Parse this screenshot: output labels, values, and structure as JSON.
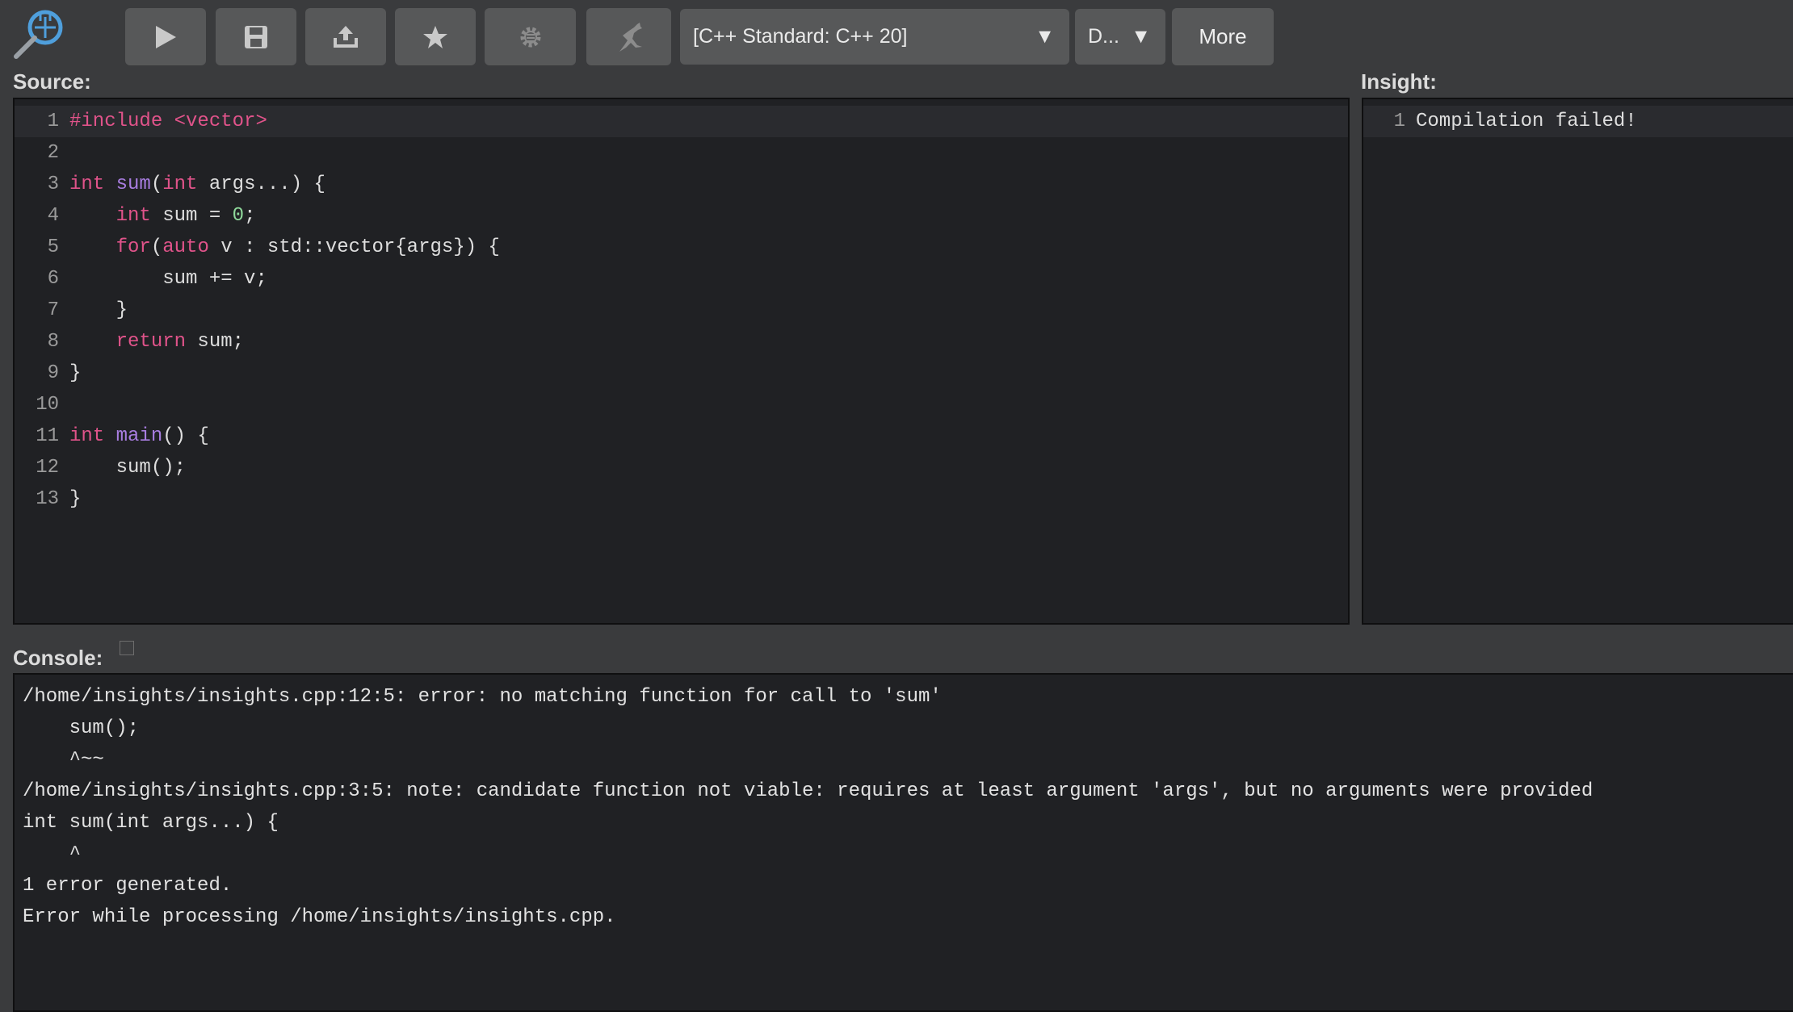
{
  "toolbar": {
    "buttons": [
      {
        "name": "run-button",
        "icon": "play-icon"
      },
      {
        "name": "save-button",
        "icon": "save-icon"
      },
      {
        "name": "upload-button",
        "icon": "upload-icon"
      },
      {
        "name": "favorite-button",
        "icon": "star-icon"
      },
      {
        "name": "settings-button",
        "icon": "gear-icon"
      },
      {
        "name": "kangaroo-button",
        "icon": "kangaroo-icon"
      }
    ],
    "standard_select": "[C++ Standard: C++ 20]",
    "secondary_select": "D...",
    "more_label": "More"
  },
  "source": {
    "label": "Source:",
    "lines": [
      {
        "n": "1",
        "parts": [
          {
            "t": "#include <vector>",
            "c": "kw"
          }
        ]
      },
      {
        "n": "2",
        "parts": []
      },
      {
        "n": "3",
        "parts": [
          {
            "t": "int",
            "c": "kw"
          },
          {
            "t": " "
          },
          {
            "t": "sum",
            "c": "fn"
          },
          {
            "t": "("
          },
          {
            "t": "int",
            "c": "kw"
          },
          {
            "t": " args...) {"
          }
        ]
      },
      {
        "n": "4",
        "parts": [
          {
            "t": "    "
          },
          {
            "t": "int",
            "c": "kw"
          },
          {
            "t": " sum = "
          },
          {
            "t": "0",
            "c": "num"
          },
          {
            "t": ";"
          }
        ]
      },
      {
        "n": "5",
        "parts": [
          {
            "t": "    "
          },
          {
            "t": "for",
            "c": "kw"
          },
          {
            "t": "("
          },
          {
            "t": "auto",
            "c": "kw"
          },
          {
            "t": " v : std::vector{args}) {"
          }
        ]
      },
      {
        "n": "6",
        "parts": [
          {
            "t": "        sum += v;"
          }
        ]
      },
      {
        "n": "7",
        "parts": [
          {
            "t": "    }"
          }
        ]
      },
      {
        "n": "8",
        "parts": [
          {
            "t": "    "
          },
          {
            "t": "return",
            "c": "kw"
          },
          {
            "t": " sum;"
          }
        ]
      },
      {
        "n": "9",
        "parts": [
          {
            "t": "}"
          }
        ]
      },
      {
        "n": "10",
        "parts": []
      },
      {
        "n": "11",
        "parts": [
          {
            "t": "int",
            "c": "kw"
          },
          {
            "t": " "
          },
          {
            "t": "main",
            "c": "fn"
          },
          {
            "t": "() {"
          }
        ]
      },
      {
        "n": "12",
        "parts": [
          {
            "t": "    sum();"
          }
        ]
      },
      {
        "n": "13",
        "parts": [
          {
            "t": "}"
          }
        ]
      }
    ]
  },
  "insight": {
    "label": "Insight:",
    "lines": [
      {
        "n": "1",
        "text": "Compilation failed!"
      }
    ]
  },
  "console": {
    "label": "Console:",
    "lines": [
      "/home/insights/insights.cpp:12:5: error: no matching function for call to 'sum'",
      "    sum();",
      "    ^~~",
      "/home/insights/insights.cpp:3:5: note: candidate function not viable: requires at least argument 'args', but no arguments were provided",
      "int sum(int args...) {",
      "    ^",
      "1 error generated.",
      "Error while processing /home/insights/insights.cpp."
    ]
  }
}
